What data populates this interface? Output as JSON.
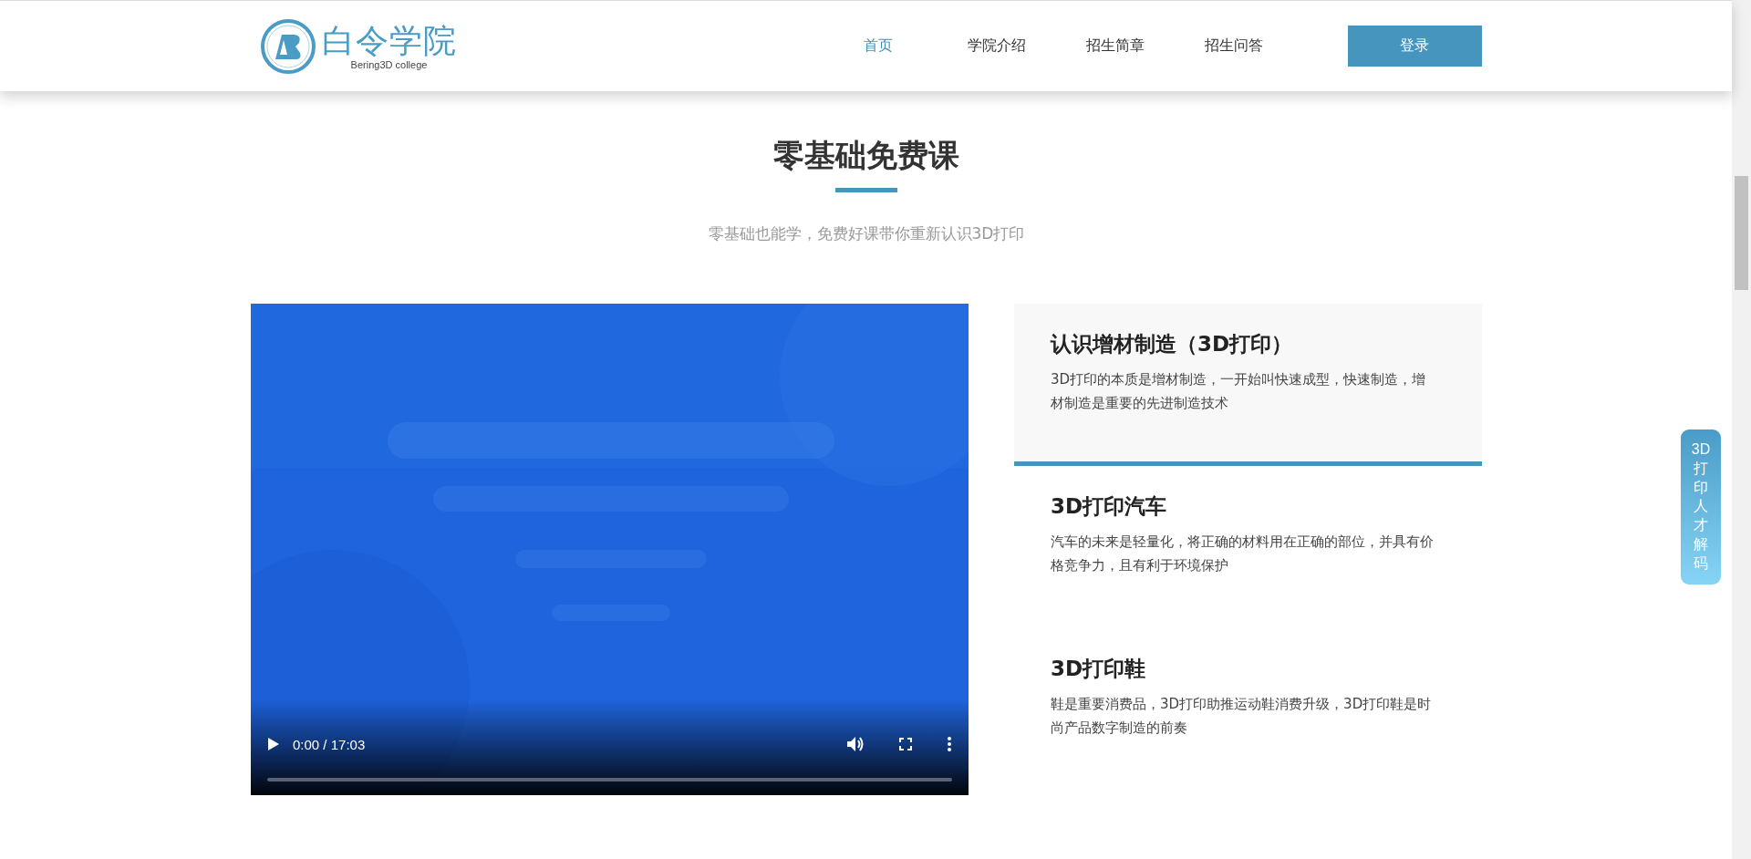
{
  "header": {
    "logo": {
      "name": "白令学院",
      "tagline": "Bering3D college"
    },
    "nav": [
      {
        "label": "首页",
        "selected": true
      },
      {
        "label": "学院介绍",
        "selected": false
      },
      {
        "label": "招生简章",
        "selected": false
      },
      {
        "label": "招生问答",
        "selected": false
      }
    ],
    "login_button": "登录"
  },
  "section": {
    "title": "零基础免费课",
    "subtitle": "零基础也能学，免费好课带你重新认识3D打印"
  },
  "video": {
    "kind": "picture",
    "time": "0:00 / 17:03"
  },
  "courses": [
    {
      "title": "认识增材制造（3D打印）",
      "description": "3D打印的本质是增材制造，一开始叫快速成型，快速制造，增材制造是重要的先进制造技术",
      "selected": true
    },
    {
      "title": "3D打印汽车",
      "description": "汽车的未来是轻量化，将正确的材料用在正确的部位，并具有价格竞争力，且有利于环境保护",
      "selected": false
    },
    {
      "title": "3D打印鞋",
      "description": "鞋是重要消费品，3D打印助推运动鞋消费升级，3D打印鞋是时尚产品数字制造的前奏",
      "selected": false
    }
  ],
  "side_tab": "3D打印人才解码"
}
